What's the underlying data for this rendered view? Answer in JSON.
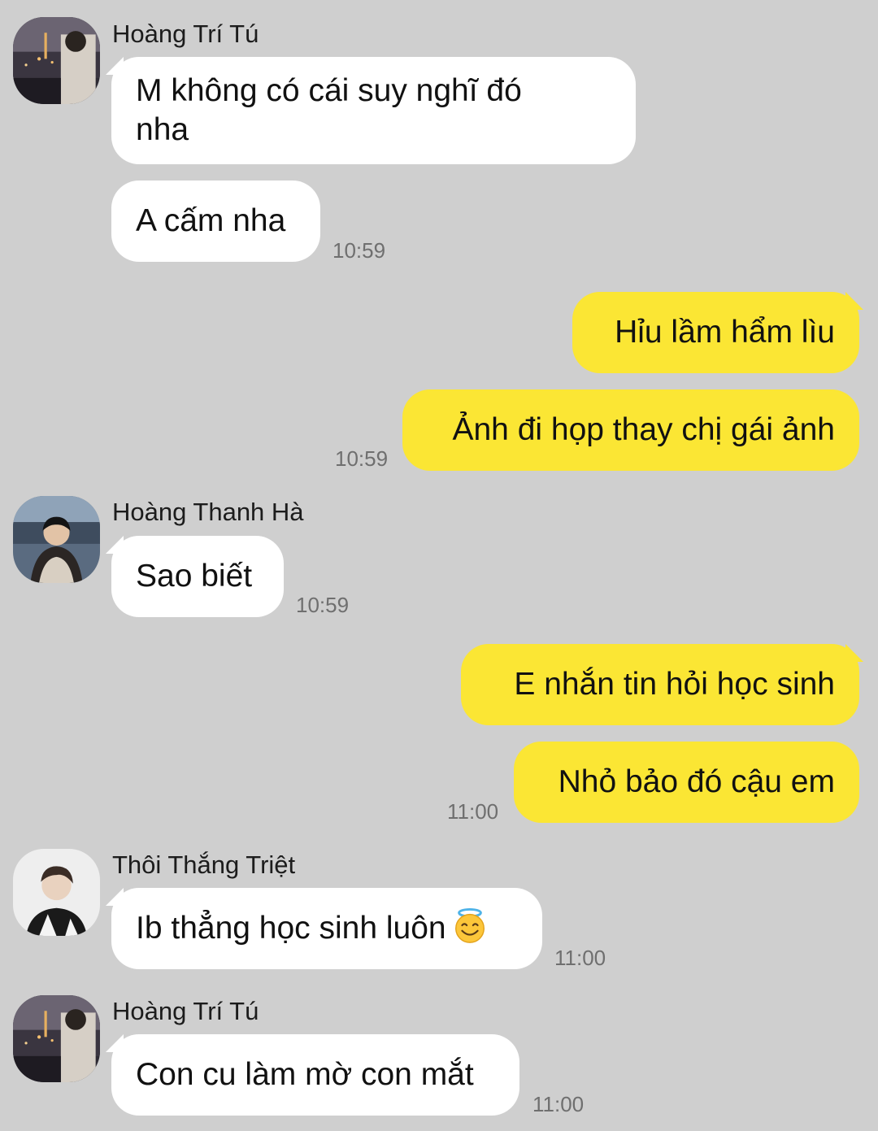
{
  "chat": {
    "groups": [
      {
        "sender": "Hoàng Trí Tú",
        "messages": [
          "M không có cái suy nghĩ đó\nnha",
          "A cấm nha"
        ],
        "time": "10:59"
      },
      {
        "sender": "me",
        "messages": [
          "Hỉu lầm hẩm lìu",
          "Ảnh đi họp thay chị gái ảnh"
        ],
        "time": "10:59"
      },
      {
        "sender": "Hoàng Thanh Hà",
        "messages": [
          "Sao biết"
        ],
        "time": "10:59"
      },
      {
        "sender": "me",
        "messages": [
          "E nhắn tin hỏi học sinh",
          "Nhỏ bảo đó cậu em"
        ],
        "time": "11:00"
      },
      {
        "sender": "Thôi Thắng Triệt",
        "messages": [
          "Ib thẳng học sinh luôn"
        ],
        "emoji": "smiling-face-with-halo",
        "time": "11:00"
      },
      {
        "sender": "Hoàng Trí Tú",
        "messages": [
          "Con cu làm mờ con mắt"
        ],
        "time": "11:00"
      }
    ]
  },
  "colors": {
    "background": "#cfcfcf",
    "incoming_bubble": "#ffffff",
    "outgoing_bubble": "#fbe634",
    "timestamp": "#6f6f6f"
  }
}
